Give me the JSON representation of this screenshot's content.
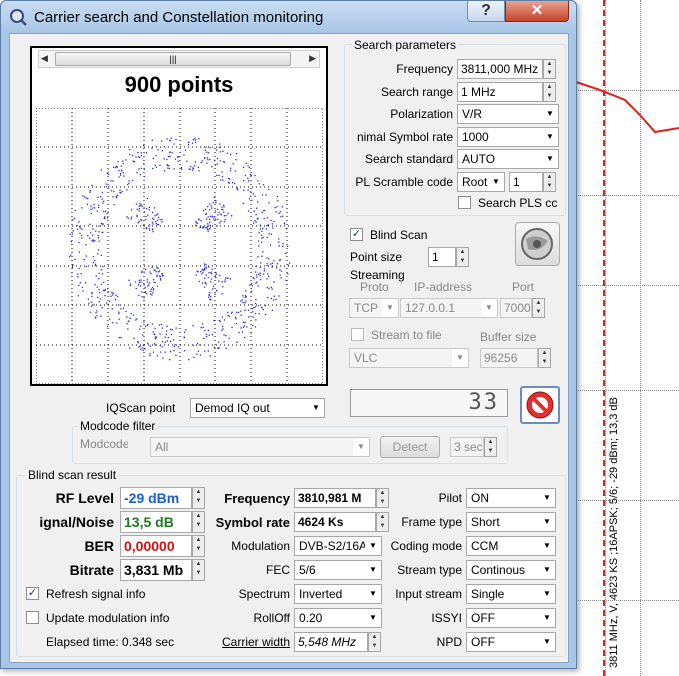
{
  "window": {
    "title": "Carrier search and Constellation monitoring",
    "help_glyph": "?",
    "close_glyph": "✕"
  },
  "constellation": {
    "points_label": "900 points"
  },
  "search_params": {
    "group_title": "Search parameters",
    "frequency_label": "Frequency",
    "frequency_value": "3811,000 MHz",
    "range_label": "Search range",
    "range_value": "1 MHz",
    "polarization_label": "Polarization",
    "polarization_value": "V/R",
    "symbol_rate_label": "nimal Symbol rate",
    "symbol_rate_value": "1000",
    "standard_label": "Search standard",
    "standard_value": "AUTO",
    "pls_label": "PL Scramble code",
    "pls_mode": "Root",
    "pls_value": "1",
    "search_pls_label": "Search PLS cc"
  },
  "blind": {
    "label": "Blind Scan",
    "point_size_label": "Point size",
    "point_size_value": "1"
  },
  "streaming": {
    "title": "Streaming",
    "proto_label": "Proto",
    "ip_label": "IP-address",
    "port_label": "Port",
    "proto_value": "TCP",
    "ip_value": "127.0.0.1",
    "port_value": "7000",
    "stream_file_label": "Stream to file",
    "buffer_label": "Buffer size",
    "player_value": "VLC",
    "buffer_value": "96256"
  },
  "iq": {
    "label": "IQScan point",
    "value": "Demod IQ out",
    "display_value": "33"
  },
  "modcode": {
    "group_title": "Modcode filter",
    "label": "Modcode",
    "value": "All",
    "detect_label": "Detect",
    "sec_value": "3 sec"
  },
  "result": {
    "group_title": "Blind scan result",
    "rf_label": "RF Level",
    "rf_value": "-29 dBm",
    "sn_label": "ignal/Noise",
    "sn_value": "13,5 dB",
    "ber_label": "BER",
    "ber_value": "0,00000",
    "bitrate_label": "Bitrate",
    "bitrate_value": "3,831 Mb",
    "freq_label": "Frequency",
    "freq_value": "3810,981 M",
    "sr_label": "Symbol rate",
    "sr_value": "4624 Ks",
    "mod_label": "Modulation",
    "mod_value": "DVB-S2/16A",
    "fec_label": "FEC",
    "fec_value": "5/6",
    "spectrum_label": "Spectrum",
    "spectrum_value": "Inverted",
    "rolloff_label": "RollOff",
    "rolloff_value": "0.20",
    "cw_label": "Carrier width",
    "cw_value": "5,548 MHz",
    "pilot_label": "Pilot",
    "pilot_value": "ON",
    "frame_label": "Frame type",
    "frame_value": "Short",
    "coding_label": "Coding mode",
    "coding_value": "CCM",
    "stype_label": "Stream type",
    "stype_value": "Continous",
    "istream_label": "Input stream",
    "istream_value": "Single",
    "issyi_label": "ISSYI",
    "issyi_value": "OFF",
    "npd_label": "NPD",
    "npd_value": "OFF",
    "refresh_label": "Refresh signal info",
    "update_label": "Update modulation info",
    "elapsed_label": "Elapsed time: 0.348 sec"
  },
  "background": {
    "marker_text": "3811 MHz, V, 4623 KS ;16APSK; 5/6; -29 dBm; 13,3 dB"
  },
  "colors": {
    "rf": "#1a5fd0",
    "sn": "#1f7a1f",
    "ber": "#d01010",
    "marker": "#e02020",
    "dots": "#2a2ad8"
  }
}
